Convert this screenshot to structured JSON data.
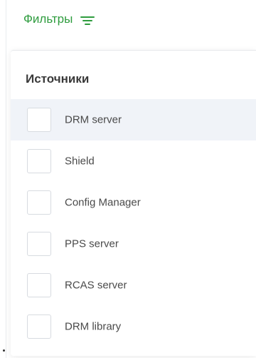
{
  "filters": {
    "toggle_label": "Фильтры",
    "icon": "filter-lines-icon",
    "accent_color": "#2e9c3e"
  },
  "sources": {
    "title": "Источники",
    "items": [
      {
        "label": "DRM server",
        "checked": false,
        "highlighted": true
      },
      {
        "label": "Shield",
        "checked": false,
        "highlighted": false
      },
      {
        "label": "Config Manager",
        "checked": false,
        "highlighted": false
      },
      {
        "label": "PPS server",
        "checked": false,
        "highlighted": false
      },
      {
        "label": "RCAS server",
        "checked": false,
        "highlighted": false
      },
      {
        "label": "DRM library",
        "checked": false,
        "highlighted": false
      }
    ]
  }
}
